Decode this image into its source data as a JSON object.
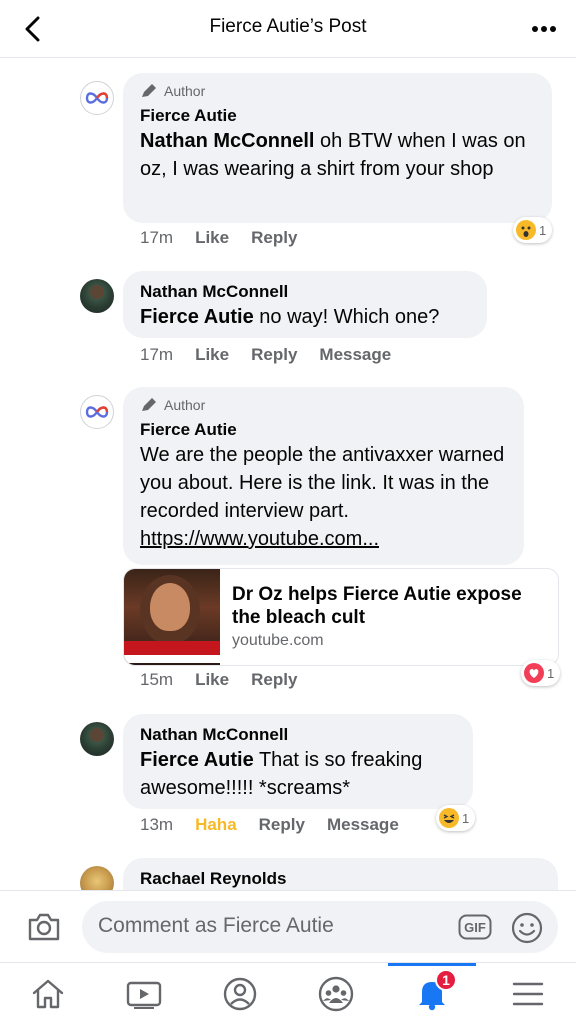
{
  "header": {
    "title": "Fierce Autie’s Post"
  },
  "comments": [
    {
      "author_label": "Author",
      "name": "Fierce Autie",
      "mention": "Nathan McConnell",
      "text": " oh BTW when I was on oz, I was wearing a shirt from your shop",
      "time": "17m",
      "actions": [
        "Like",
        "Reply"
      ],
      "reaction": {
        "emoji": "wow",
        "count": "1"
      }
    },
    {
      "name": "Nathan McConnell",
      "mention": "Fierce Autie",
      "text": " no way! Which one?",
      "time": "17m",
      "actions": [
        "Like",
        "Reply",
        "Message"
      ]
    },
    {
      "author_label": "Author",
      "name": "Fierce Autie",
      "text": "We are the people the antivaxxer warned you about. Here is the link. It was in the recorded interview part.",
      "link": "https://www.youtube.com...",
      "preview": {
        "title": "Dr Oz helps Fierce Autie expose the bleach cult",
        "domain": "youtube.com"
      },
      "time": "15m",
      "actions": [
        "Like",
        "Reply"
      ],
      "reaction": {
        "emoji": "love",
        "count": "1"
      }
    },
    {
      "name": "Nathan McConnell",
      "mention": "Fierce Autie",
      "text": " That is so freaking awesome!!!!! *screams*",
      "time": "13m",
      "actions": [
        "Haha",
        "Reply",
        "Message"
      ],
      "reaction": {
        "emoji": "haha",
        "count": "1"
      }
    },
    {
      "name": "Rachael Reynolds"
    }
  ],
  "composer": {
    "placeholder": "Comment as Fierce Autie",
    "gif_label": "GIF"
  },
  "tabbar": {
    "notifications_badge": "1"
  },
  "colors": {
    "accent": "#1877f2",
    "haha": "#f7b928",
    "badge": "#e41e3f",
    "bubble": "#f0f2f5"
  }
}
